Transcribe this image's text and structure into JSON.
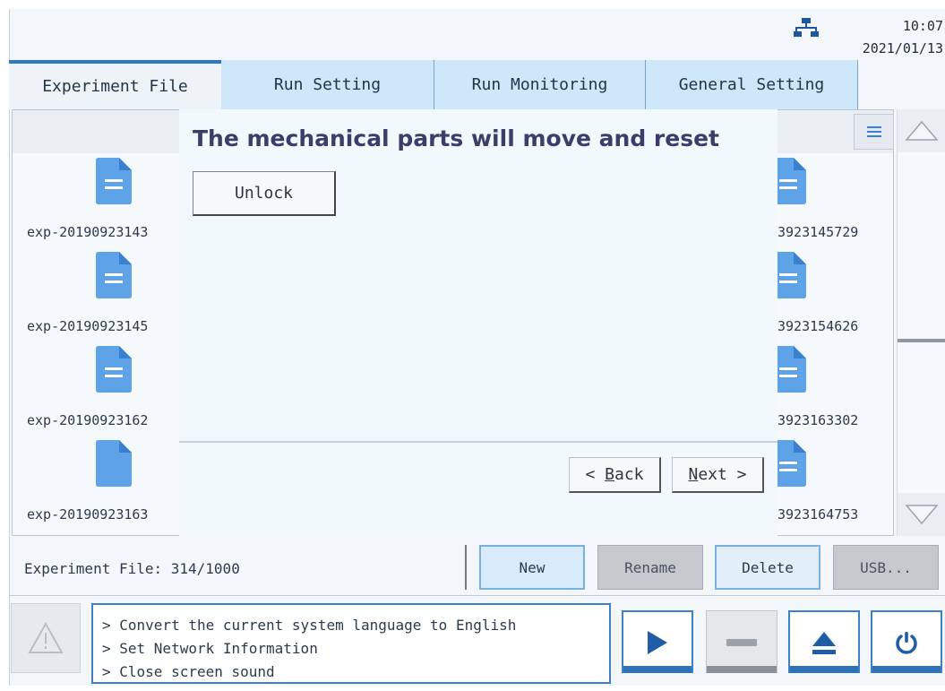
{
  "header": {
    "time": "10:07",
    "date": "2021/01/13",
    "network_icon": "network-icon"
  },
  "tabs": [
    {
      "label": "Experiment File",
      "active": true
    },
    {
      "label": "Run Setting",
      "active": false
    },
    {
      "label": "Run Monitoring",
      "active": false
    },
    {
      "label": "General Setting",
      "active": false
    }
  ],
  "files": {
    "left": [
      "exp-20190923143",
      "exp-20190923145",
      "exp-20190923162",
      "exp-20190923163"
    ],
    "right": [
      "3923145729",
      "3923154626",
      "3923163302",
      "3923164753"
    ]
  },
  "dialog": {
    "title": "The mechanical parts will move and reset",
    "unlock_label": "Unlock",
    "back_prefix": "< ",
    "back_key": "B",
    "back_rest": "ack",
    "next_key": "N",
    "next_rest": "ext",
    "next_suffix": " >"
  },
  "status": {
    "file_count": "Experiment File: 314/1000",
    "new_label": "New",
    "rename_label": "Rename",
    "delete_label": "Delete",
    "usb_label": "USB..."
  },
  "messages": [
    "> Convert the current system language to English",
    "> Set Network Information",
    "> Close screen sound"
  ],
  "colors": {
    "accent": "#2e72b9",
    "tab_inactive": "#cfe7fb",
    "dialog_bg": "#f2f9fd",
    "disabled": "#c6c9cc"
  }
}
